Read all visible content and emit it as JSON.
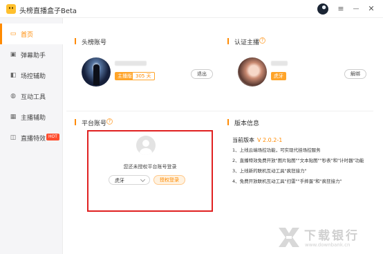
{
  "app": {
    "title": "头榜直播盒子Beta"
  },
  "window_controls": {
    "menu": "≡",
    "minimize": "—",
    "close": "✕"
  },
  "sidebar": {
    "items": [
      {
        "label": "首页",
        "icon": "monitor-icon",
        "glyph": "▭",
        "active": true
      },
      {
        "label": "弹幕助手",
        "icon": "chat-icon",
        "glyph": "▣",
        "active": false
      },
      {
        "label": "场控辅助",
        "icon": "control-icon",
        "glyph": "◧",
        "active": false
      },
      {
        "label": "互动工具",
        "icon": "globe-icon",
        "glyph": "◍",
        "active": false
      },
      {
        "label": "主播辅助",
        "icon": "grid-icon",
        "glyph": "▦",
        "active": false
      },
      {
        "label": "直播特效",
        "icon": "gift-icon",
        "glyph": "◫",
        "active": false,
        "badge": "HOT"
      }
    ]
  },
  "toubang_account": {
    "title": "头榜账号",
    "tag_role": "主播版",
    "tag_days": "305 天",
    "logout_label": "退出"
  },
  "certified_anchor": {
    "title": "认证主播",
    "info_glyph": "?",
    "platform_tag": "虎牙",
    "unbind_label": "解绑"
  },
  "platform_account": {
    "title": "平台账号",
    "info_glyph": "?",
    "not_authorized_text": "您还未授权平台账号登录",
    "platform_select_value": "虎牙",
    "authorize_label": "授权登录"
  },
  "version_info": {
    "title": "版本信息",
    "current_label": "当前版本",
    "current_version": "V 2.0.2-1",
    "changelog": [
      "1、上线云端场控功能，可实现代挂场控服务",
      "2、直播特效免费开放\"图片贴图\"\"文本贴图\"\"秒表\"和\"计时器\"功能",
      "3、上线新的联机互动工具\"疯狂接力\"",
      "4、免费开放联机互动工具\"扫雷\"\"手摔蛋\"和\"疯狂接力\""
    ]
  },
  "watermark": {
    "title": "下载银行",
    "url": "www.downbank.cn"
  },
  "colors": {
    "accent": "#ff8a00",
    "tag_bg": "#ffa429",
    "highlight_border": "#e02020",
    "hot_badge": "#ff4d2e"
  }
}
